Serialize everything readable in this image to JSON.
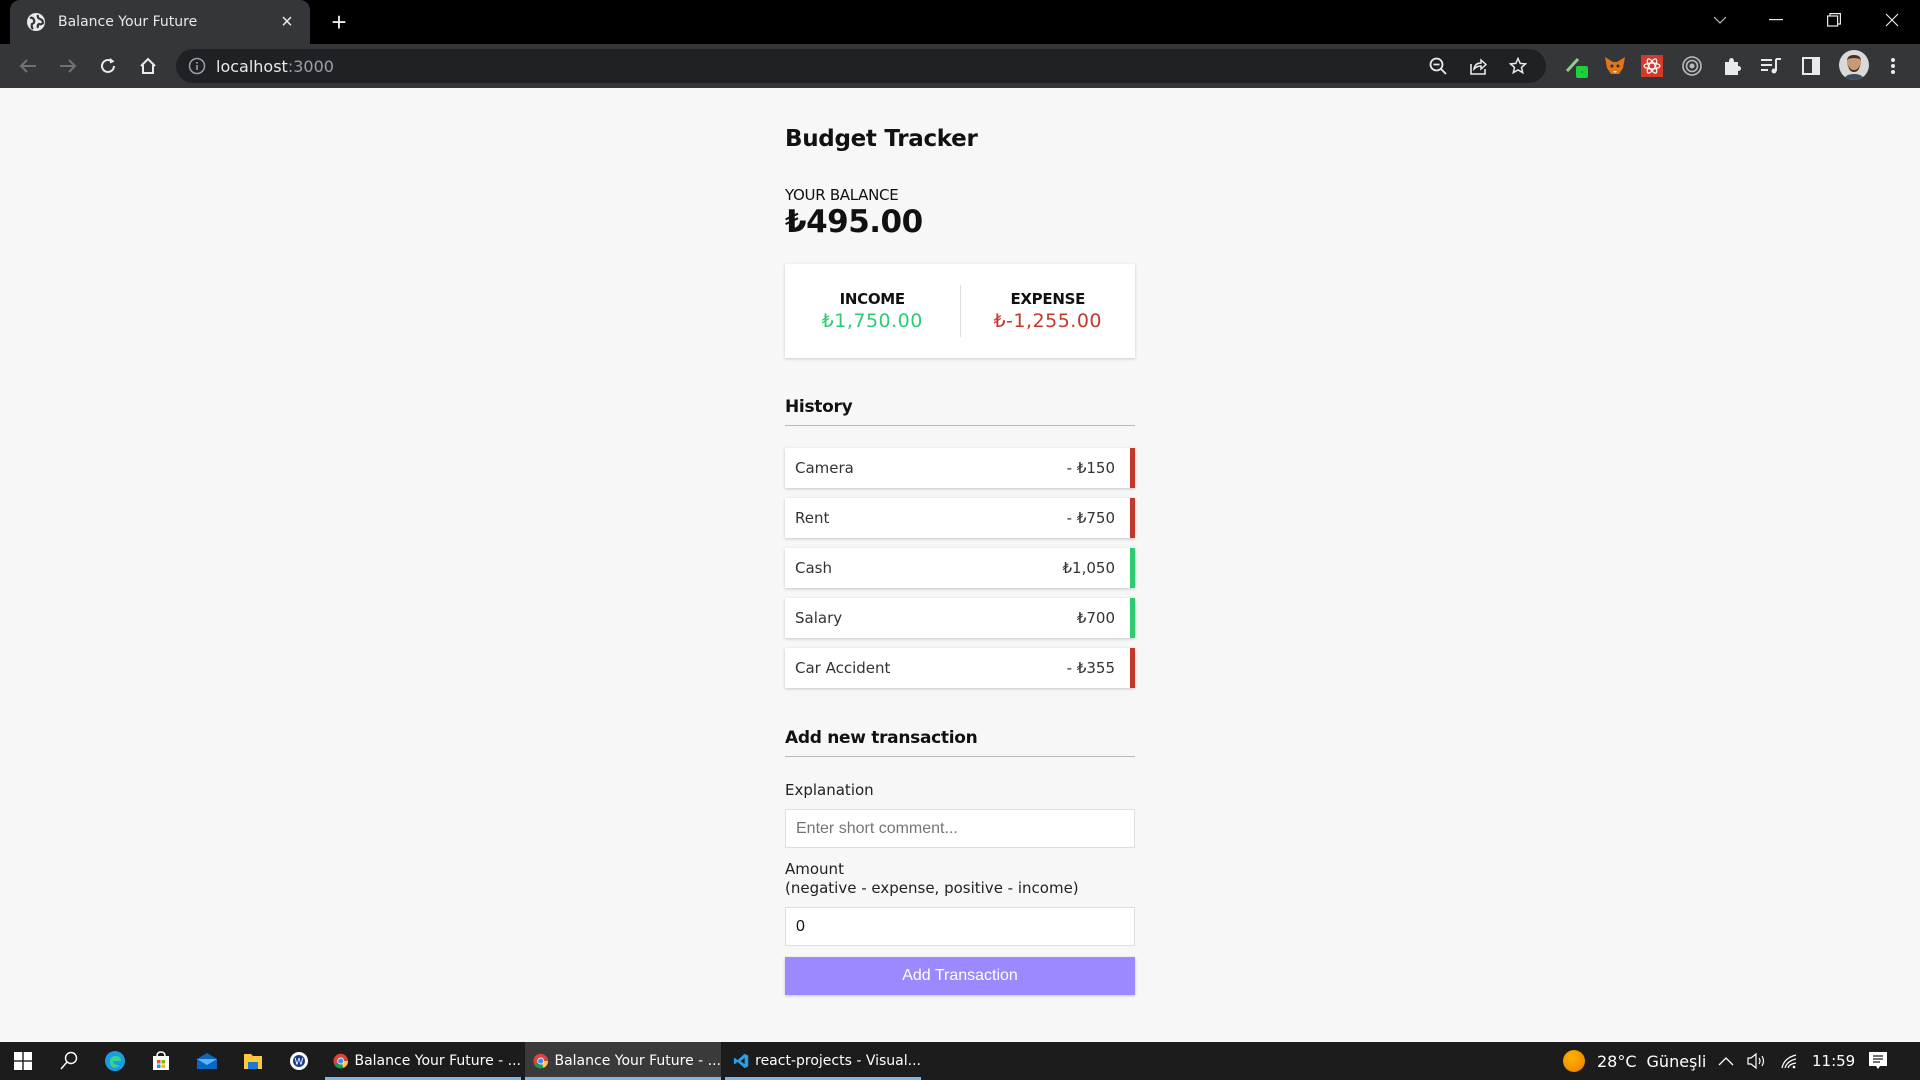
{
  "browser": {
    "tab_title": "Balance Your Future",
    "url_host": "localhost",
    "url_port": ":3000",
    "icons": {
      "tab": "globe-icon",
      "close": "close-icon",
      "new_tab": "plus-icon",
      "back": "arrow-left-icon",
      "forward": "arrow-right-icon",
      "reload": "reload-icon",
      "home": "home-icon",
      "site_info": "info-icon",
      "zoom": "zoom-out-icon",
      "share": "share-icon",
      "bookmark": "star-icon",
      "extensions": [
        "eyedropper-extension-icon",
        "metamask-fox-icon",
        "react-devtools-icon",
        "target-extension-icon",
        "puzzle-extensions-icon",
        "media-queue-icon",
        "side-panel-icon"
      ],
      "profile": "avatar",
      "menu": "kebab-menu-icon"
    }
  },
  "app": {
    "title": "Budget Tracker",
    "balance_label": "YOUR BALANCE",
    "balance_value": "₺495.00",
    "income_label": "INCOME",
    "income_value": "₺1,750.00",
    "expense_label": "EXPENSE",
    "expense_value": "₺-1,255.00",
    "history_title": "History",
    "transactions": [
      {
        "text": "Camera",
        "amount": "- ₺150",
        "type": "minus"
      },
      {
        "text": "Rent",
        "amount": "- ₺750",
        "type": "minus"
      },
      {
        "text": "Cash",
        "amount": "₺1,050",
        "type": "plus"
      },
      {
        "text": "Salary",
        "amount": "₺700",
        "type": "plus"
      },
      {
        "text": "Car Accident",
        "amount": "- ₺355",
        "type": "minus"
      }
    ],
    "form": {
      "title": "Add new transaction",
      "explanation_label": "Explanation",
      "explanation_placeholder": "Enter short comment...",
      "explanation_value": "",
      "amount_label": "Amount",
      "amount_hint": "(negative - expense, positive - income)",
      "amount_value": "0",
      "submit_label": "Add Transaction"
    },
    "colors": {
      "income": "#2ecc71",
      "expense": "#c0392b",
      "button": "#9c88ff"
    }
  },
  "taskbar": {
    "pinned": [
      "windows-start-icon",
      "search-icon",
      "edge-icon",
      "store-icon",
      "mail-icon",
      "file-explorer-icon",
      "word-icon"
    ],
    "apps": [
      {
        "label": "Balance Your Future - ...",
        "icon": "chrome-icon"
      },
      {
        "label": "Balance Your Future - ...",
        "icon": "chrome-icon"
      },
      {
        "label": "react-projects - Visual...",
        "icon": "vscode-icon"
      }
    ],
    "weather": "28°C",
    "weather_desc": "Güneşli",
    "time": "11:59"
  }
}
